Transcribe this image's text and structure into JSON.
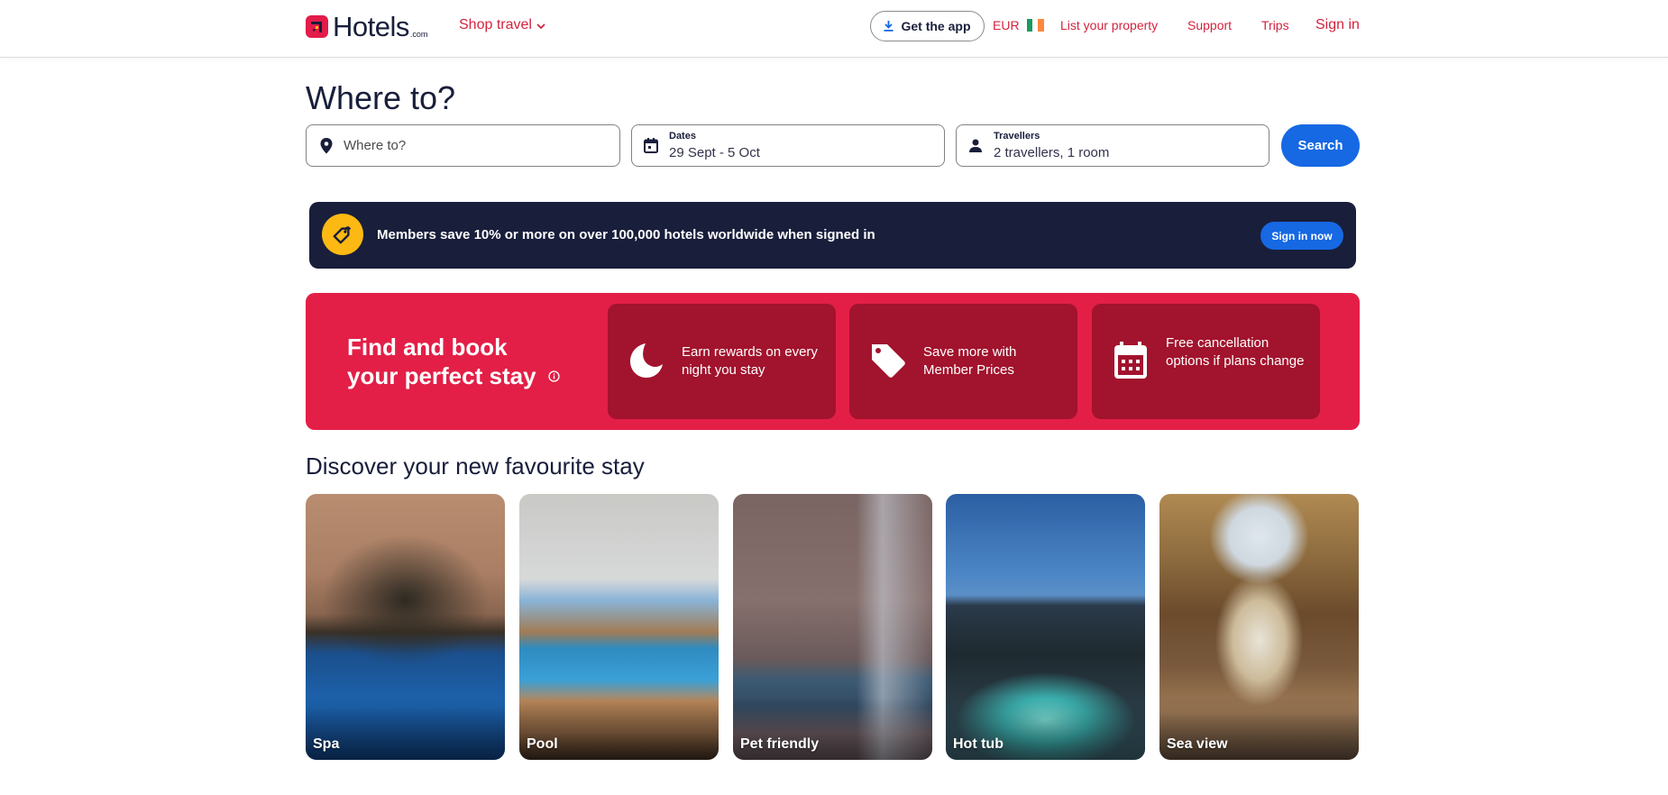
{
  "header": {
    "brand_name": "Hotels",
    "brand_suffix": ".com",
    "shop_travel_label": "Shop travel",
    "get_app_label": "Get the app",
    "currency_label": "EUR",
    "currency_flag": "ireland-flag",
    "nav_links": [
      {
        "label": "List your property"
      },
      {
        "label": "Support"
      },
      {
        "label": "Trips"
      },
      {
        "label": "Sign in"
      }
    ]
  },
  "search": {
    "title": "Where to?",
    "destination": {
      "placeholder": "Where to?",
      "icon": "map-pin-icon"
    },
    "dates": {
      "label": "Dates",
      "value": "29 Sept - 5 Oct",
      "icon": "calendar-icon"
    },
    "travellers": {
      "label": "Travellers",
      "value": "2 travellers, 1 room",
      "icon": "person-icon"
    },
    "search_button_label": "Search"
  },
  "member_banner": {
    "text": "Members save 10% or more on over 100,000 hotels worldwide when signed in",
    "button_label": "Sign in now",
    "icon": "member-tag-icon"
  },
  "promo": {
    "title": "Find and book your perfect stay",
    "cards": [
      {
        "icon": "moon-icon",
        "text": "Earn rewards on every night you stay"
      },
      {
        "icon": "price-tag-icon",
        "text": "Save more with Member Prices"
      },
      {
        "icon": "calendar-icon",
        "text": "Free cancellation options if plans change"
      }
    ]
  },
  "discover": {
    "title": "Discover your new favourite stay",
    "cards": [
      {
        "label": "Spa"
      },
      {
        "label": "Pool"
      },
      {
        "label": "Pet friendly"
      },
      {
        "label": "Hot tub"
      },
      {
        "label": "Sea view"
      }
    ]
  },
  "colors": {
    "brand_red": "#e31c4a",
    "link_red": "#d3233f",
    "primary_blue": "#1668e3",
    "navy": "#191e3b",
    "promo_red": "#e31f47",
    "promo_card": "#a2132d",
    "member_gold": "#fdb913"
  }
}
